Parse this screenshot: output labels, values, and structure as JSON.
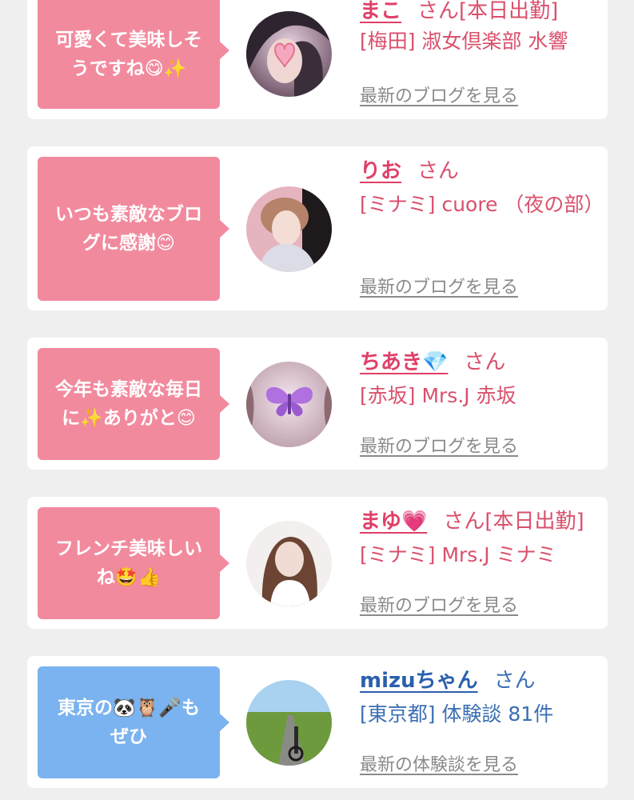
{
  "cards": [
    {
      "theme": "pink",
      "message": [
        "可愛くて美味しそ",
        "うですね😋✨"
      ],
      "name": "まこ",
      "honorific": "さん",
      "status": "[本日出勤]",
      "shop": "[梅田] 淑女倶楽部 水響",
      "more_link": "最新のブログを見る",
      "avatar_icon": "heart-sticker-icon"
    },
    {
      "theme": "pink",
      "message": [
        "いつも素敵なブロ",
        "グに感謝😊"
      ],
      "name": "りお",
      "honorific": "さん",
      "status": "",
      "shop": "[ミナミ] cuore （夜の部）",
      "more_link": "最新のブログを見る",
      "avatar_icon": ""
    },
    {
      "theme": "pink",
      "message": [
        "今年も素敵な毎日",
        "に✨ありがと😊"
      ],
      "name": "ちあき💎",
      "honorific": "さん",
      "status": "",
      "shop": "[赤坂] Mrs.J 赤坂",
      "more_link": "最新のブログを見る",
      "avatar_icon": "butterfly-sticker-icon"
    },
    {
      "theme": "pink",
      "message": [
        "フレンチ美味しい",
        "ね🤩👍"
      ],
      "name": "まゆ💗",
      "honorific": "さん",
      "status": "[本日出勤]",
      "shop": "[ミナミ] Mrs.J ミナミ",
      "more_link": "最新のブログを見る",
      "avatar_icon": ""
    },
    {
      "theme": "blue",
      "message": [
        "東京の🐼🦉🎤も",
        "ぜひ"
      ],
      "name": "mizuちゃん",
      "honorific": "さん",
      "status": "",
      "shop": "[東京都] 体験談 81件",
      "more_link": "最新の体験談を見る",
      "avatar_icon": ""
    }
  ],
  "colors": {
    "pink_bubble": "#f28a9e",
    "blue_bubble": "#7ab3ef",
    "pink_text": "#d9506c",
    "blue_text": "#3b6fb4",
    "link_gray": "#8a8a8a",
    "background": "#efefef"
  }
}
